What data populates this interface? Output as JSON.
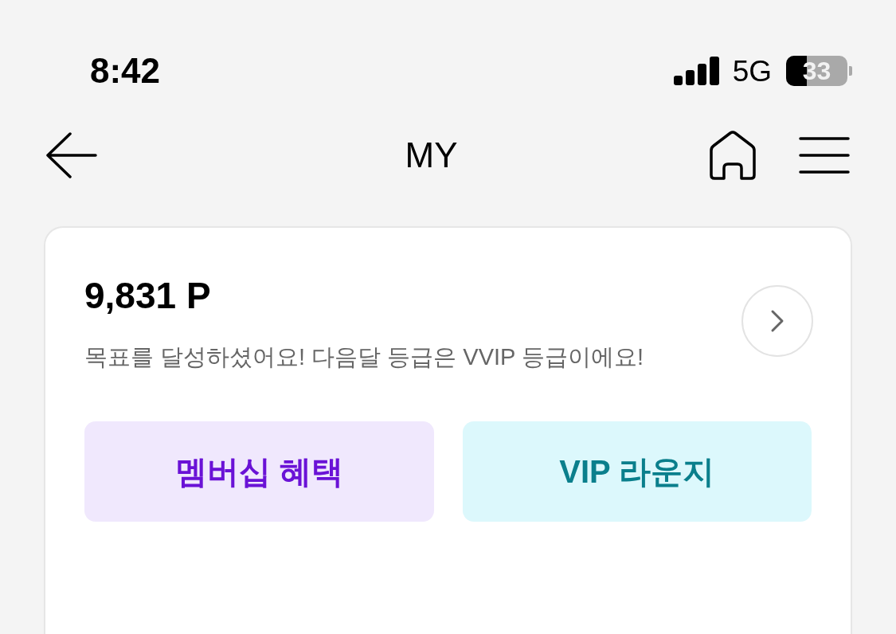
{
  "status_bar": {
    "time": "8:42",
    "network": "5G",
    "battery": "33"
  },
  "nav": {
    "title": "MY"
  },
  "points_card": {
    "points": "9,831 P",
    "message": "목표를 달성하셨어요! 다음달 등급은 VVIP 등급이에요!"
  },
  "actions": [
    {
      "label": "멤버십 혜택",
      "kind": "membership"
    },
    {
      "label": "VIP 라운지",
      "kind": "lounge"
    }
  ]
}
